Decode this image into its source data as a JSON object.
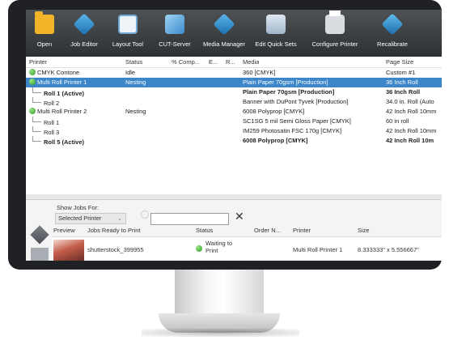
{
  "toolbar": {
    "items": [
      {
        "label": "Open",
        "icon": "folder-icon"
      },
      {
        "label": "Job Editor",
        "icon": "job-editor-icon"
      },
      {
        "label": "Layout Tool",
        "icon": "layout-tool-icon"
      },
      {
        "label": "CUT-Server",
        "icon": "cut-server-icon"
      },
      {
        "label": "Media Manager",
        "icon": "media-manager-icon"
      },
      {
        "label": "Edit Quick Sets",
        "icon": "quick-sets-icon"
      },
      {
        "label": "Configure Printer",
        "icon": "printer-icon"
      },
      {
        "label": "Recalibrate",
        "icon": "recalibrate-icon"
      }
    ]
  },
  "printers": {
    "headers": [
      "Printer",
      "Status",
      "% Comp...",
      "E...",
      "R...",
      "Media",
      "Page Size"
    ],
    "rows": [
      {
        "printer": "CMYK Contone",
        "status": "Idle",
        "media": "360 [CMYK]",
        "page": "Custom #1",
        "level": 0,
        "dot": true,
        "bold": false,
        "selected": false
      },
      {
        "printer": "Multi Roll Printer 1",
        "status": "Nesting",
        "media": "Plain Paper 70gsm [Production]",
        "page": "36 Inch Roll",
        "level": 0,
        "dot": true,
        "bold": false,
        "selected": true
      },
      {
        "printer": "Roll 1 (Active)",
        "status": "",
        "media": "Plain Paper 70gsm [Production]",
        "page": "36 Inch Roll",
        "level": 1,
        "dot": false,
        "bold": true,
        "selected": false
      },
      {
        "printer": "Roll 2",
        "status": "",
        "media": "Banner with DuPont Tyvek [Production]",
        "page": "34.0 in. Roll (Auto",
        "level": 1,
        "dot": false,
        "bold": false,
        "selected": false
      },
      {
        "printer": "Multi Roll Printer 2",
        "status": "Nesting",
        "media": "6008 Polyprop [CMYK]",
        "page": "42 Inch Roll 10mm",
        "level": 0,
        "dot": true,
        "bold": false,
        "selected": false
      },
      {
        "printer": "Roll 1",
        "status": "",
        "media": "SC1SG 5 mil Semi Gloss Paper [CMYK]",
        "page": "60 in roll",
        "level": 1,
        "dot": false,
        "bold": false,
        "selected": false
      },
      {
        "printer": "Roll 3",
        "status": "",
        "media": "IM259 Photosatin FSC 170g [CMYK]",
        "page": "42 Inch Roll 10mm",
        "level": 1,
        "dot": false,
        "bold": false,
        "selected": false
      },
      {
        "printer": "Roll 5 (Active)",
        "status": "",
        "media": "6008 Polyprop [CMYK]",
        "page": "42 Inch Roll 10m",
        "level": 1,
        "dot": false,
        "bold": true,
        "selected": false
      }
    ]
  },
  "jobs": {
    "show_label": "Show Jobs For:",
    "filter_value": "Selected Printer",
    "search_value": "",
    "headers": [
      "Preview",
      "Jobs Ready to Print",
      "Status",
      "Order N...",
      "Printer",
      "Size"
    ],
    "rows": [
      {
        "name": "shutterstock_399955",
        "status": "Waiting to Print",
        "order": "",
        "printer": "Multi Roll Printer 1",
        "size": "8.333333\" x 5.556667\""
      }
    ]
  }
}
